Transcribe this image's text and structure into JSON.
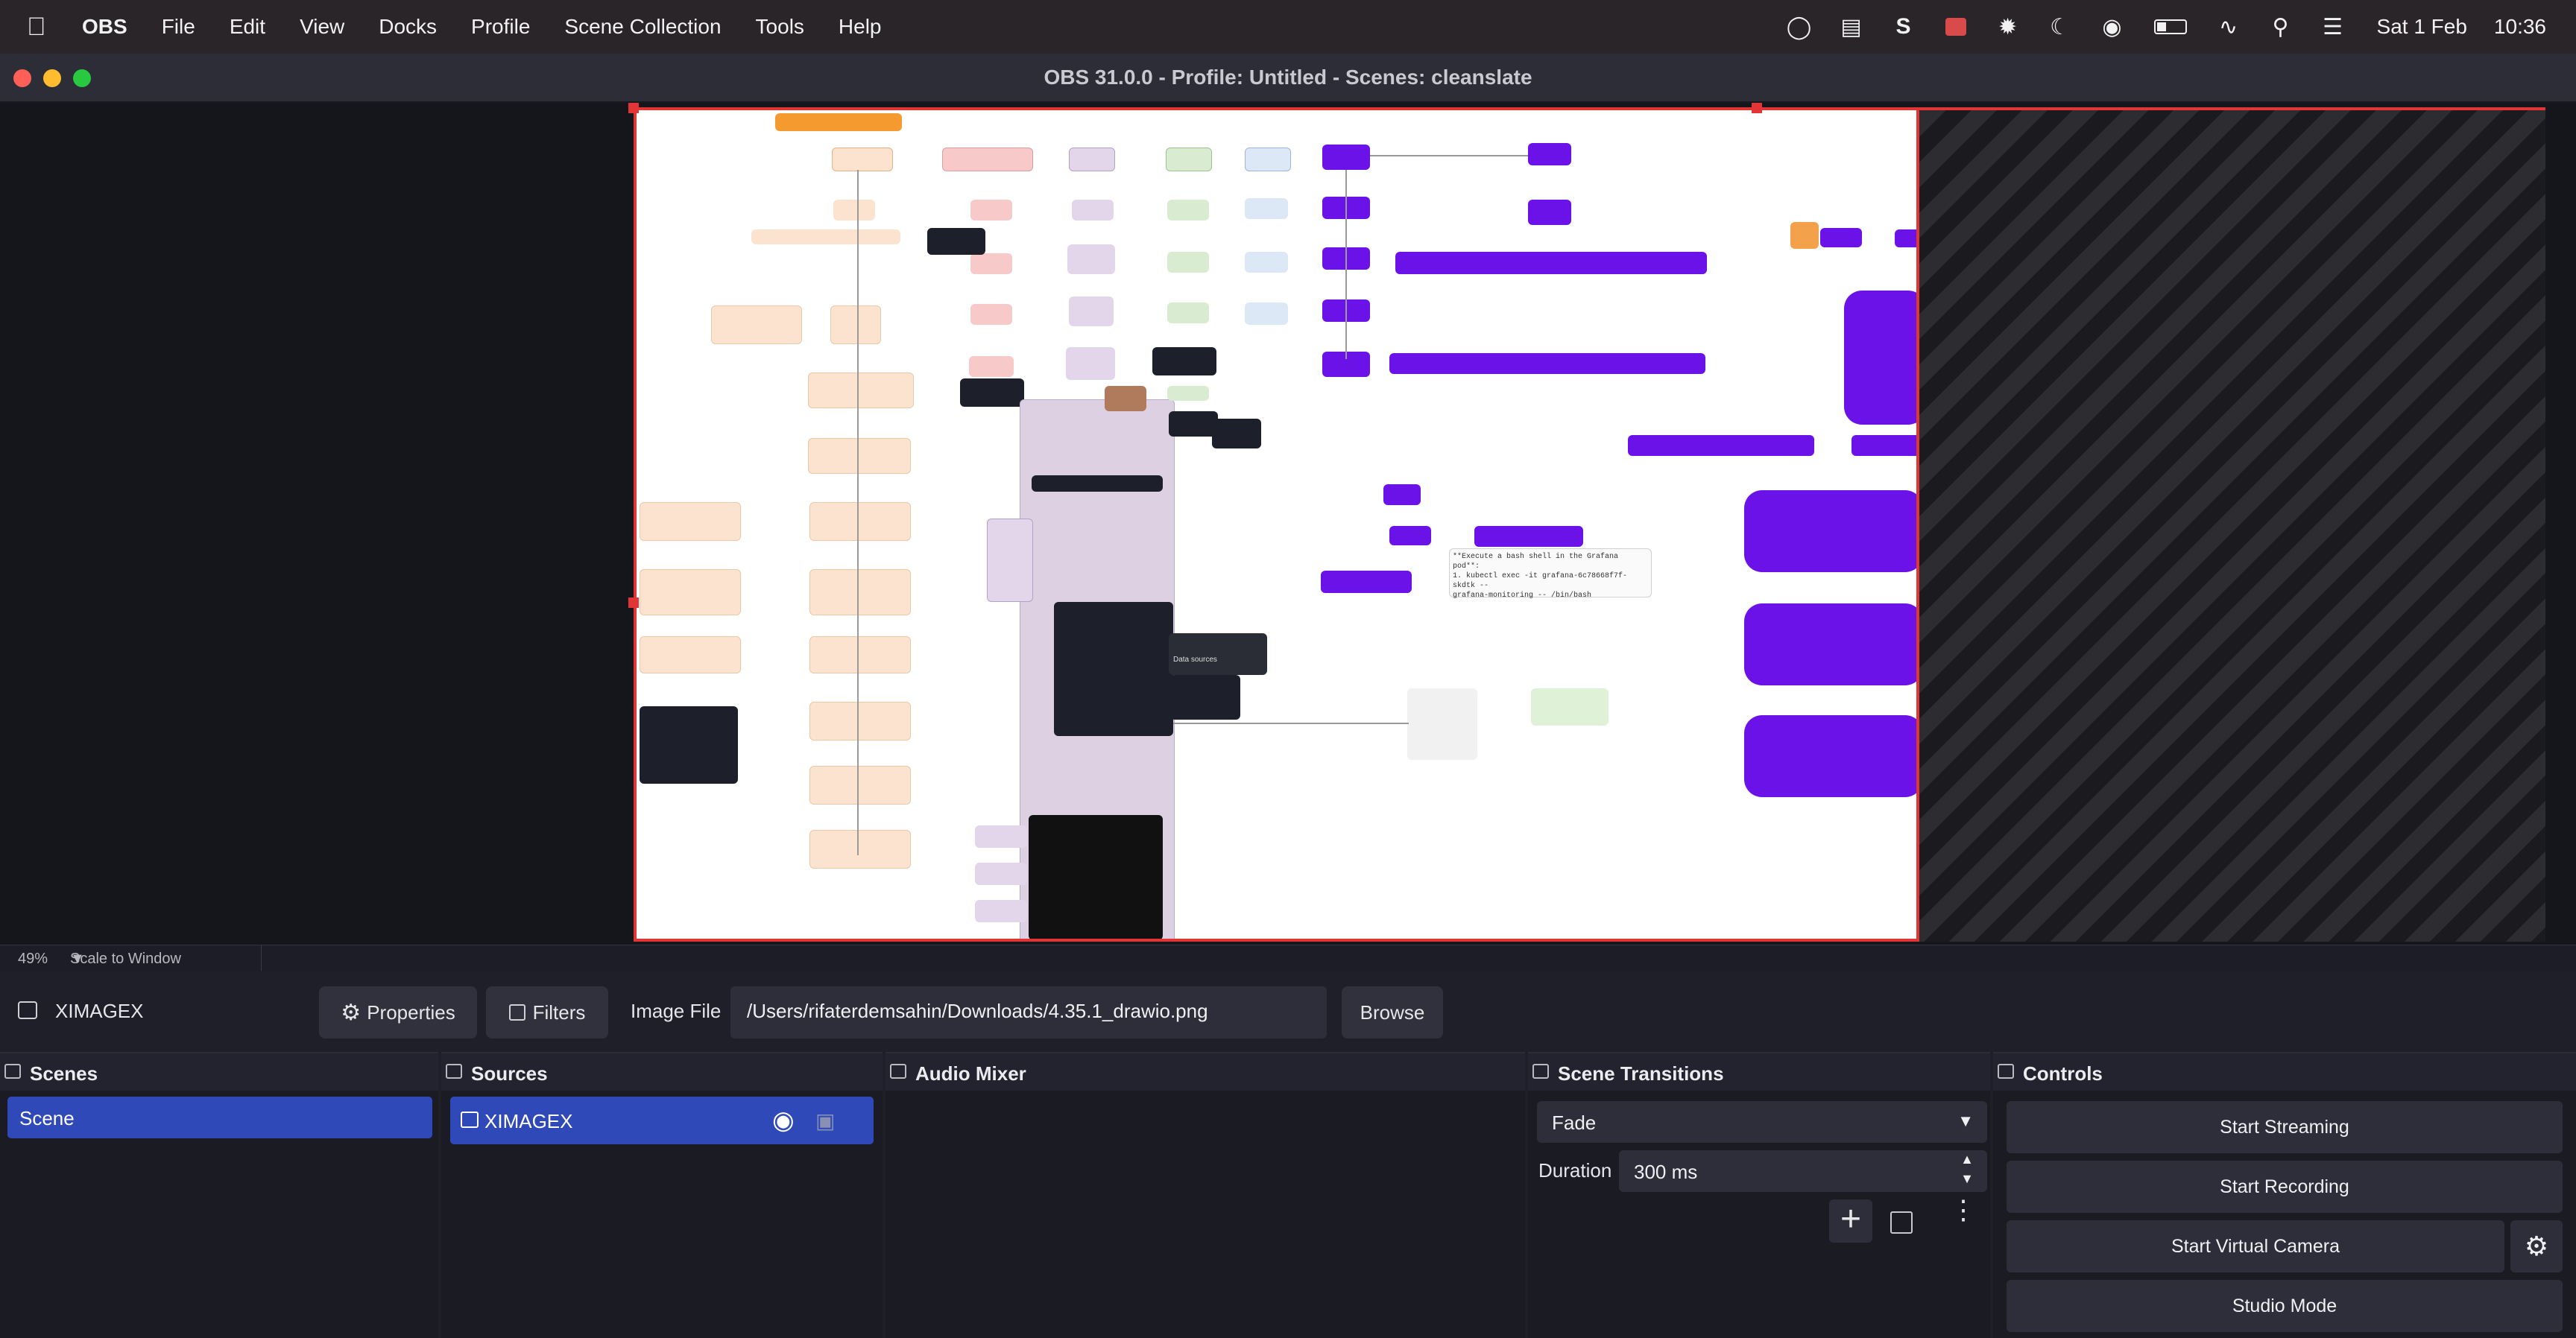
{
  "menubar": {
    "app": "OBS",
    "items": [
      "File",
      "Edit",
      "View",
      "Docks",
      "Profile",
      "Scene Collection",
      "Tools",
      "Help"
    ],
    "date": "Sat 1 Feb",
    "time": "10:36",
    "status_icons": [
      "app-icon",
      "chart-icon",
      "s-icon",
      "recording-icon",
      "gear-sun-icon",
      "moon-icon",
      "user-icon",
      "battery-icon",
      "wifi-icon",
      "search-icon",
      "control-center-icon"
    ]
  },
  "window": {
    "title": "OBS 31.0.0 - Profile: Untitled - Scenes: cleanslate"
  },
  "preview": {
    "zoom": "49%",
    "scale_mode": "Scale to Window",
    "diagram_texts": {
      "fn1": "1. kubectl exec -it grafana-6c78668f7f-skdtk --",
      "fn2": "grafana-monitoring -- /bin/bash",
      "fn0": "**Execute a bash shell in the Grafana pod**:",
      "ds": "Data sources"
    }
  },
  "source_toolbar": {
    "source_name": "XIMAGEX",
    "properties": "Properties",
    "filters": "Filters",
    "image_file_label": "Image File",
    "image_file_path": "/Users/rifaterdemsahin/Downloads/4.35.1_drawio.png",
    "browse": "Browse"
  },
  "docks": {
    "scenes": {
      "title": "Scenes",
      "items": [
        "Scene"
      ]
    },
    "sources": {
      "title": "Sources",
      "items": [
        "XIMAGEX"
      ]
    },
    "audio_mixer": {
      "title": "Audio Mixer"
    },
    "transitions": {
      "title": "Scene Transitions",
      "transition": "Fade",
      "duration_label": "Duration",
      "duration_value": "300 ms"
    },
    "controls": {
      "title": "Controls",
      "start_streaming": "Start Streaming",
      "start_recording": "Start Recording",
      "start_virtual_camera": "Start Virtual Camera",
      "studio_mode": "Studio Mode"
    }
  },
  "colors": {
    "accent": "#2f4ab8",
    "selection_border": "#e23636",
    "diagram_purple": "#6a12e8",
    "diagram_orange": "#fbe3cf",
    "diagram_lavender": "#e4d6ea"
  }
}
